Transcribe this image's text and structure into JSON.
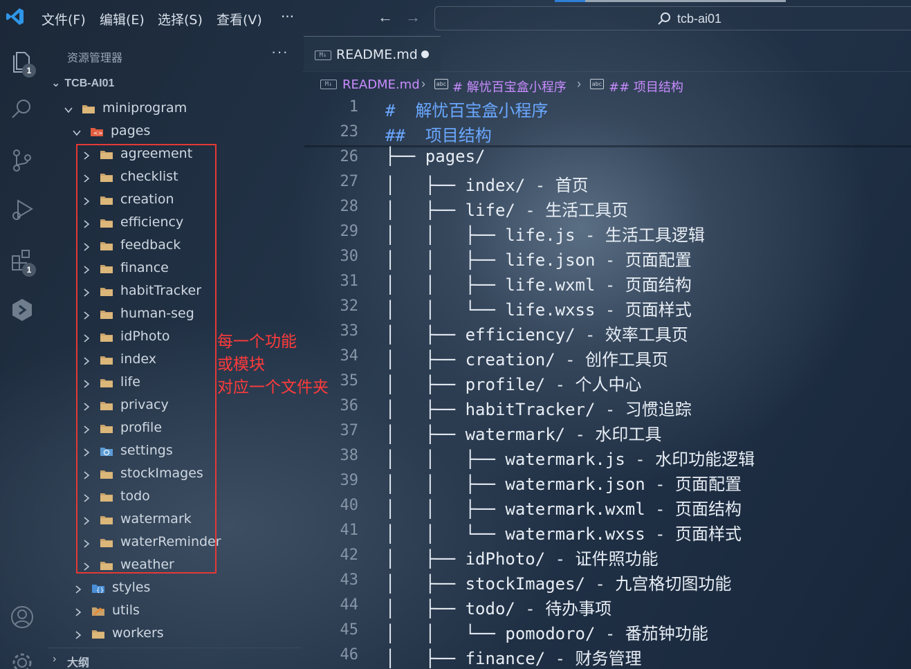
{
  "menu": [
    "文件(F)",
    "编辑(E)",
    "选择(S)",
    "查看(V)",
    "···"
  ],
  "search": {
    "text": "tcb-ai01"
  },
  "activity": {
    "explorer_badge": "1",
    "extensions_badge": "1"
  },
  "sidebar": {
    "title": "资源管理器",
    "more": "···",
    "root": "TCB-AI01",
    "tree": {
      "miniprogram": "miniprogram",
      "pages": "pages",
      "page_folders": [
        "agreement",
        "checklist",
        "creation",
        "efficiency",
        "feedback",
        "finance",
        "habitTracker",
        "human-seg",
        "idPhoto",
        "index",
        "life",
        "privacy",
        "profile",
        "settings",
        "stockImages",
        "todo",
        "watermark",
        "waterReminder",
        "weather"
      ],
      "after": [
        "styles",
        "utils",
        "workers"
      ]
    },
    "outline": "大纲"
  },
  "annotation": [
    "每一个功能",
    "或模块",
    "对应一个文件夹"
  ],
  "colors": {
    "annotation": "#ff3b3b",
    "accent": "#2f7fd6",
    "header": "#6aa8ff",
    "breadcrumb": "#c98cff"
  },
  "editor": {
    "tab": "README.md",
    "breadcrumb": [
      "README.md",
      "# 解忧百宝盒小程序",
      "## 项目结构"
    ],
    "lines": [
      {
        "n": "1",
        "t": "#  解忧百宝盒小程序"
      },
      {
        "n": "23",
        "t": "##  项目结构"
      },
      {
        "n": "26",
        "t": "├── pages/"
      },
      {
        "n": "27",
        "t": "│   ├── index/ - 首页"
      },
      {
        "n": "28",
        "t": "│   ├── life/ - 生活工具页"
      },
      {
        "n": "29",
        "t": "│   │   ├── life.js - 生活工具逻辑"
      },
      {
        "n": "30",
        "t": "│   │   ├── life.json - 页面配置"
      },
      {
        "n": "31",
        "t": "│   │   ├── life.wxml - 页面结构"
      },
      {
        "n": "32",
        "t": "│   │   └── life.wxss - 页面样式"
      },
      {
        "n": "33",
        "t": "│   ├── efficiency/ - 效率工具页"
      },
      {
        "n": "34",
        "t": "│   ├── creation/ - 创作工具页"
      },
      {
        "n": "35",
        "t": "│   ├── profile/ - 个人中心"
      },
      {
        "n": "36",
        "t": "│   ├── habitTracker/ - 习惯追踪"
      },
      {
        "n": "37",
        "t": "│   ├── watermark/ - 水印工具"
      },
      {
        "n": "38",
        "t": "│   │   ├── watermark.js - 水印功能逻辑"
      },
      {
        "n": "39",
        "t": "│   │   ├── watermark.json - 页面配置"
      },
      {
        "n": "40",
        "t": "│   │   ├── watermark.wxml - 页面结构"
      },
      {
        "n": "41",
        "t": "│   │   └── watermark.wxss - 页面样式"
      },
      {
        "n": "42",
        "t": "│   ├── idPhoto/ - 证件照功能"
      },
      {
        "n": "43",
        "t": "│   ├── stockImages/ - 九宫格切图功能"
      },
      {
        "n": "44",
        "t": "│   ├── todo/ - 待办事项"
      },
      {
        "n": "45",
        "t": "│   │   └── pomodoro/ - 番茄钟功能"
      },
      {
        "n": "46",
        "t": "│   ├── finance/ - 财务管理"
      }
    ]
  }
}
